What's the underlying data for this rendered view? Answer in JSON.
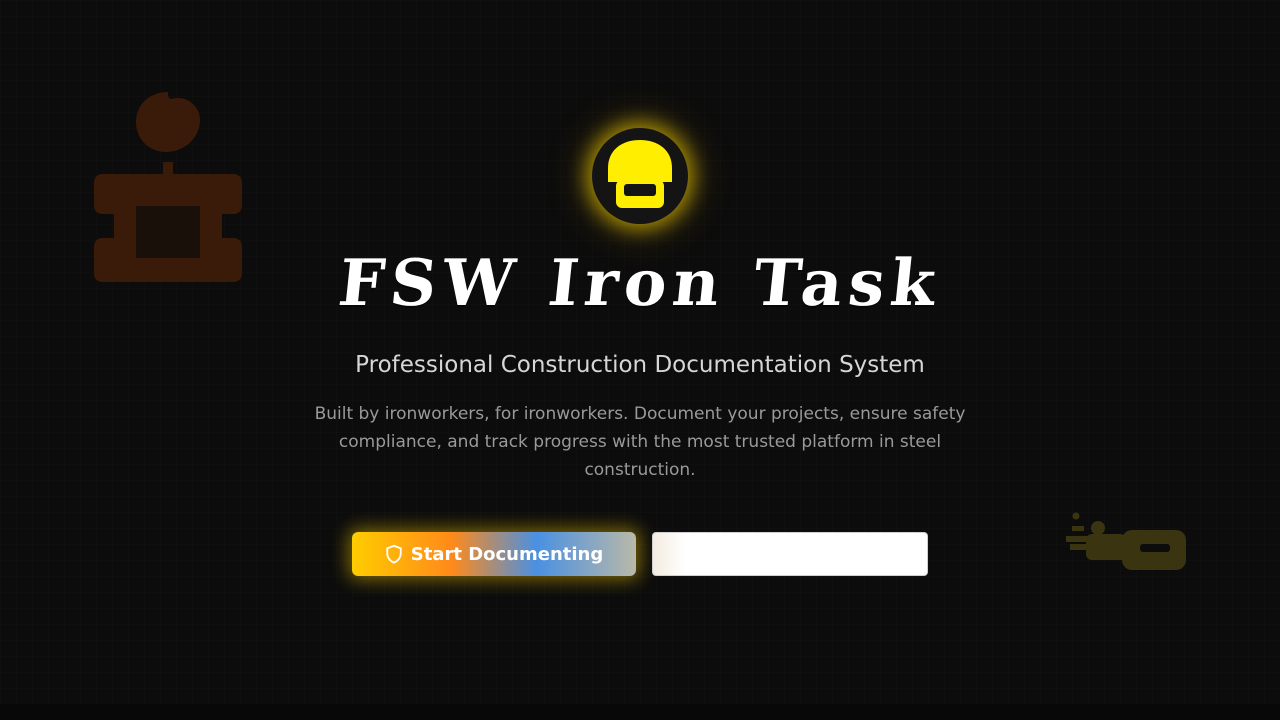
{
  "hero": {
    "title": "FSW Iron Task",
    "subtitle": "Professional Construction Documentation System",
    "description": "Built by ironworkers, for ironworkers. Document your projects, ensure safety compliance, and track progress with the most trusted platform in steel construction."
  },
  "actions": {
    "primary_label": "Start Documenting",
    "secondary_label": ""
  },
  "icons": {
    "logo": "hard-hat-icon",
    "primary_button": "shield-icon",
    "decor_left": "crane-hook-icon",
    "decor_right": "bolt-wrench-icon"
  },
  "colors": {
    "accent": "#FFEE00",
    "background": "#0C0C0C",
    "decor_left": "#3A1A08",
    "decor_right": "#3A3510"
  }
}
